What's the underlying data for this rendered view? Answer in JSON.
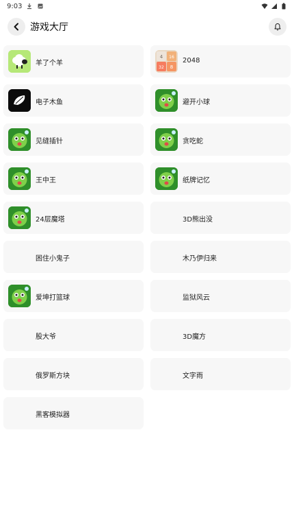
{
  "status": {
    "time": "9:03"
  },
  "header": {
    "title": "游戏大厅"
  },
  "games": [
    {
      "label": "羊了个羊",
      "icon": "sheep-icon"
    },
    {
      "label": "2048",
      "icon": "2048-icon"
    },
    {
      "label": "电子木鱼",
      "icon": "wooden-fish-icon"
    },
    {
      "label": "避开小球",
      "icon": "frog-icon"
    },
    {
      "label": "见缝插针",
      "icon": "frog-icon"
    },
    {
      "label": "贪吃蛇",
      "icon": "frog-icon"
    },
    {
      "label": "王中王",
      "icon": "frog-icon"
    },
    {
      "label": "纸牌记忆",
      "icon": "frog-icon"
    },
    {
      "label": "24层魔塔",
      "icon": "frog-icon"
    },
    {
      "label": "3D熊出没",
      "icon": ""
    },
    {
      "label": "困住小鬼子",
      "icon": ""
    },
    {
      "label": "木乃伊归来",
      "icon": ""
    },
    {
      "label": "爱坤打篮球",
      "icon": "frog-icon"
    },
    {
      "label": "监狱风云",
      "icon": ""
    },
    {
      "label": "股大爷",
      "icon": ""
    },
    {
      "label": "3D魔方",
      "icon": ""
    },
    {
      "label": "俄罗斯方块",
      "icon": ""
    },
    {
      "label": "文字雨",
      "icon": ""
    },
    {
      "label": "黑客模拟器",
      "icon": ""
    }
  ],
  "tile_2048": {
    "a": "4",
    "b": "16",
    "c": "32",
    "d": "8"
  },
  "colors": {
    "card_bg": "#f7f7f7",
    "frog_green": "#2f8f2a",
    "sheep_bg": "#b6e878"
  }
}
